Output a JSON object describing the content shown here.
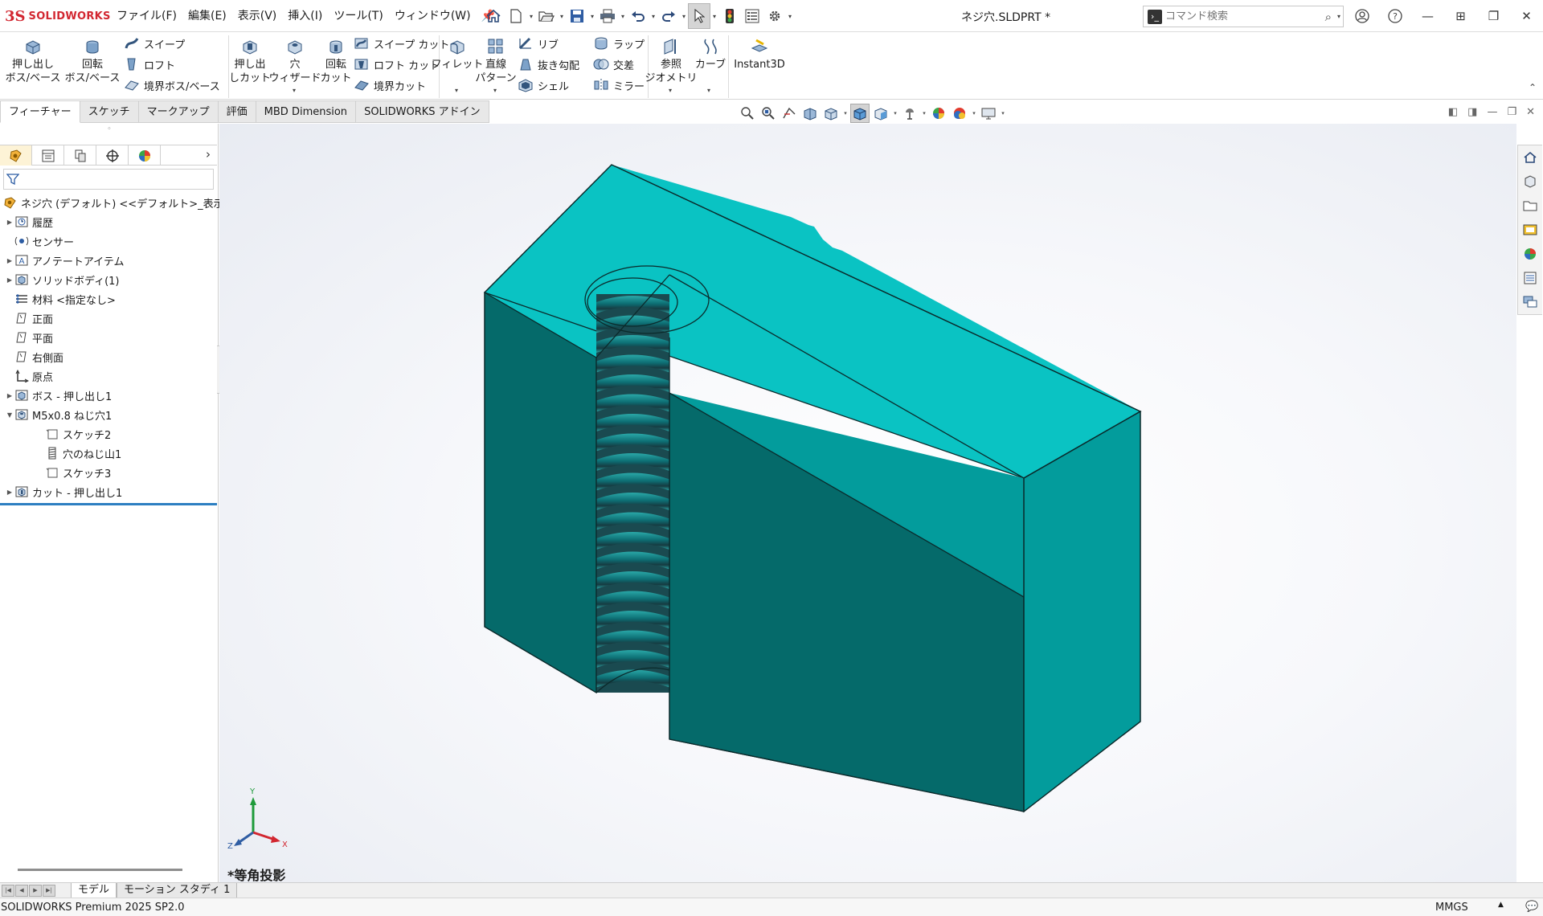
{
  "app": {
    "brand": "SOLIDWORKS",
    "document_title": "ネジ穴.SLDPRT *"
  },
  "menu": [
    "ファイル(F)",
    "編集(E)",
    "表示(V)",
    "挿入(I)",
    "ツール(T)",
    "ウィンドウ(W)"
  ],
  "command_search": {
    "placeholder": "コマンド検索"
  },
  "ribbon": {
    "boss_extrude": "押し出し\nボス/ベース",
    "revolve_boss": "回転\nボス/ベース",
    "sweep": "スイープ",
    "loft": "ロフト",
    "boundary_boss": "境界ボス/ベース",
    "extruded_cut": "押し出\nしカット",
    "hole_wizard": "穴\nウィザード",
    "revolved_cut": "回転\nカット",
    "swept_cut": "スイープ カット",
    "lofted_cut": "ロフト カット",
    "boundary_cut": "境界カット",
    "fillet": "フィレット",
    "linear_pattern": "直線\nパターン",
    "rib": "リブ",
    "draft": "抜き勾配",
    "shell": "シェル",
    "wrap": "ラップ",
    "intersect": "交差",
    "mirror": "ミラー",
    "reference_geometry": "参照\nジオメトリ",
    "curves": "カーブ",
    "instant3d": "Instant3D"
  },
  "command_tabs": [
    "フィーチャー",
    "スケッチ",
    "マークアップ",
    "評価",
    "MBD Dimension",
    "SOLIDWORKS アドイン"
  ],
  "tree": {
    "root": "ネジ穴 (デフォルト) <<デフォルト>_表示状態",
    "items": [
      {
        "label": "履歴",
        "icon": "history-icon",
        "expandable": true
      },
      {
        "label": "センサー",
        "icon": "sensor-icon",
        "expandable": false
      },
      {
        "label": "アノテートアイテム",
        "icon": "annotation-icon",
        "expandable": true
      },
      {
        "label": "ソリッドボディ(1)",
        "icon": "solid-body-icon",
        "expandable": true
      },
      {
        "label": "材料 <指定なし>",
        "icon": "material-icon",
        "expandable": false
      },
      {
        "label": "正面",
        "icon": "plane-icon",
        "expandable": false
      },
      {
        "label": "平面",
        "icon": "plane-icon",
        "expandable": false
      },
      {
        "label": "右側面",
        "icon": "plane-icon",
        "expandable": false
      },
      {
        "label": "原点",
        "icon": "origin-icon",
        "expandable": false
      },
      {
        "label": "ボス - 押し出し1",
        "icon": "extrude-icon",
        "expandable": true
      },
      {
        "label": "M5x0.8 ねじ穴1",
        "icon": "hole-icon",
        "expandable": true,
        "expanded": true
      },
      {
        "label": "スケッチ2",
        "icon": "sketch-icon",
        "child": true
      },
      {
        "label": "穴のねじ山1",
        "icon": "thread-icon",
        "child": true
      },
      {
        "label": "スケッチ3",
        "icon": "sketch-icon",
        "child": true
      },
      {
        "label": "カット - 押し出し1",
        "icon": "cut-extrude-icon",
        "expandable": true
      }
    ]
  },
  "viewport": {
    "view_label": "*等角投影",
    "triad": {
      "x": "X",
      "y": "Y",
      "z": "Z"
    },
    "colors": {
      "top": "#0ac3c3",
      "front_left": "#056a6a",
      "front_right": "#039c9c",
      "thread_dark": "#1a3a40",
      "thread_light": "#2aa8a8"
    }
  },
  "bottom_tabs": [
    "モデル",
    "モーション スタディ 1"
  ],
  "status": {
    "product": "SOLIDWORKS Premium 2025 SP2.0",
    "units": "MMGS"
  }
}
